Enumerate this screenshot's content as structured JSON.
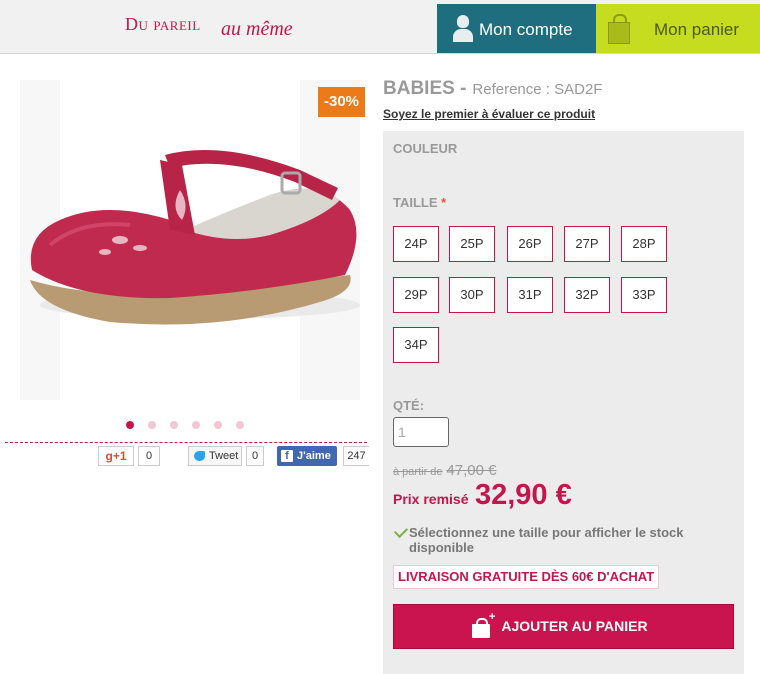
{
  "header": {
    "logo_part1": "Du pareil",
    "logo_part2": "au même",
    "account_label": "Mon compte",
    "basket_label": "Mon panier",
    "account_color": "#1e6e80",
    "basket_color": "#c6dc1e",
    "brand_color": "#c5164c"
  },
  "product": {
    "discount_badge": "-30%",
    "image_icon": "pink-tbar-shoe-image",
    "carousel_dots": 6,
    "carousel_active_index": 0,
    "social": {
      "gplus_label": "g+1",
      "gplus_count": "0",
      "tweet_label": "Tweet",
      "tweet_count": "0",
      "like_label": "J'aime",
      "like_count": "247"
    },
    "brand": "BABIES -",
    "reference": "Reference : SAD2F",
    "review_link": "Soyez le premier à évaluer ce produit",
    "color_label": "COULEUR",
    "size_label": "TAILLE",
    "size_required_marker": "*",
    "sizes": [
      "24P",
      "25P",
      "26P",
      "27P",
      "28P",
      "29P",
      "30P",
      "31P",
      "32P",
      "33P",
      "34P"
    ],
    "qty_label": "QTÉ:",
    "qty_value": "1",
    "old_price_prefix": "à partir de",
    "old_price": "47,00 €",
    "price_label": "Prix remisé",
    "price": "32,90 €",
    "stock_message": "Sélectionnez une taille pour afficher le stock disponible",
    "shipping_banner": "LIVRAISON GRATUITE DÈS 60€ D'ACHAT",
    "add_to_cart": "AJOUTER AU PANIER"
  }
}
